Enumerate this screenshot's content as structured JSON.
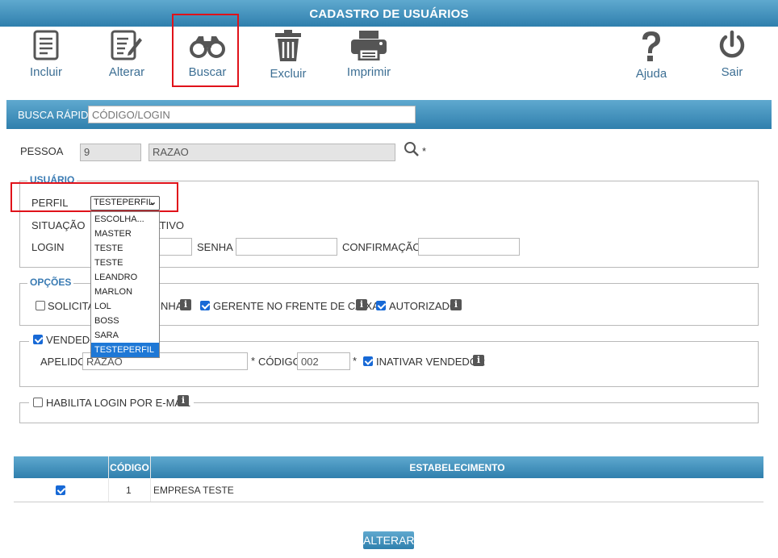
{
  "window": {
    "title": "CADASTRO DE USUÁRIOS"
  },
  "toolbar": {
    "incluir": "Incluir",
    "alterar": "Alterar",
    "buscar": "Buscar",
    "excluir": "Excluir",
    "imprimir": "Imprimir",
    "ajuda": "Ajuda",
    "sair": "Sair",
    "label_color": "#3d6f94"
  },
  "quick_search": {
    "label": "BUSCA RÁPIDA",
    "placeholder": "CÓDIGO/LOGIN"
  },
  "pessoa": {
    "label": "PESSOA",
    "code": "9",
    "name": "RAZAO",
    "required": "*"
  },
  "usuario": {
    "legend": "USUÁRIO",
    "perfil_label": "PERFIL",
    "perfil_value": "TESTEPERFIL",
    "situacao_label": "SITUAÇÃO",
    "situacao_value": "ATIVO",
    "login_label": "LOGIN",
    "senha_label": "SENHA",
    "confirmacao_label": "CONFIRMAÇÃO",
    "perfil_options": [
      "ESCOLHA...",
      "MASTER",
      "TESTE",
      "TESTE",
      "LEANDRO",
      "MARLON",
      "LOL",
      "BOSS",
      "SARA",
      "TESTEPERFIL"
    ]
  },
  "opcoes": {
    "legend": "OPÇÕES",
    "solicitar_prefix": "SOLICITAR",
    "solicitar_suffix": "NHA",
    "gerente": "GERENTE NO FRENTE DE CAIXA",
    "autorizado": "AUTORIZADO"
  },
  "vendedor": {
    "legend": "VENDEDOR",
    "apelido_label": "APELIDO",
    "apelido_value": "RAZAO",
    "codigo_label": "CÓDIGO",
    "codigo_value": "002",
    "inativar": "INATIVAR VENDEDOR",
    "required": "*"
  },
  "email_login": {
    "label": "HABILITA LOGIN POR E-MAIL"
  },
  "table": {
    "headers": [
      "",
      "CÓDIGO",
      "ESTABELECIMENTO"
    ],
    "rows": [
      {
        "checked": true,
        "codigo": "1",
        "estabelecimento": "EMPRESA TESTE"
      }
    ]
  },
  "actions": {
    "alterar": "ALTERAR"
  },
  "colors": {
    "header": "#2f7fad",
    "accent": "#1769d6",
    "highlight": "#e0121a"
  }
}
